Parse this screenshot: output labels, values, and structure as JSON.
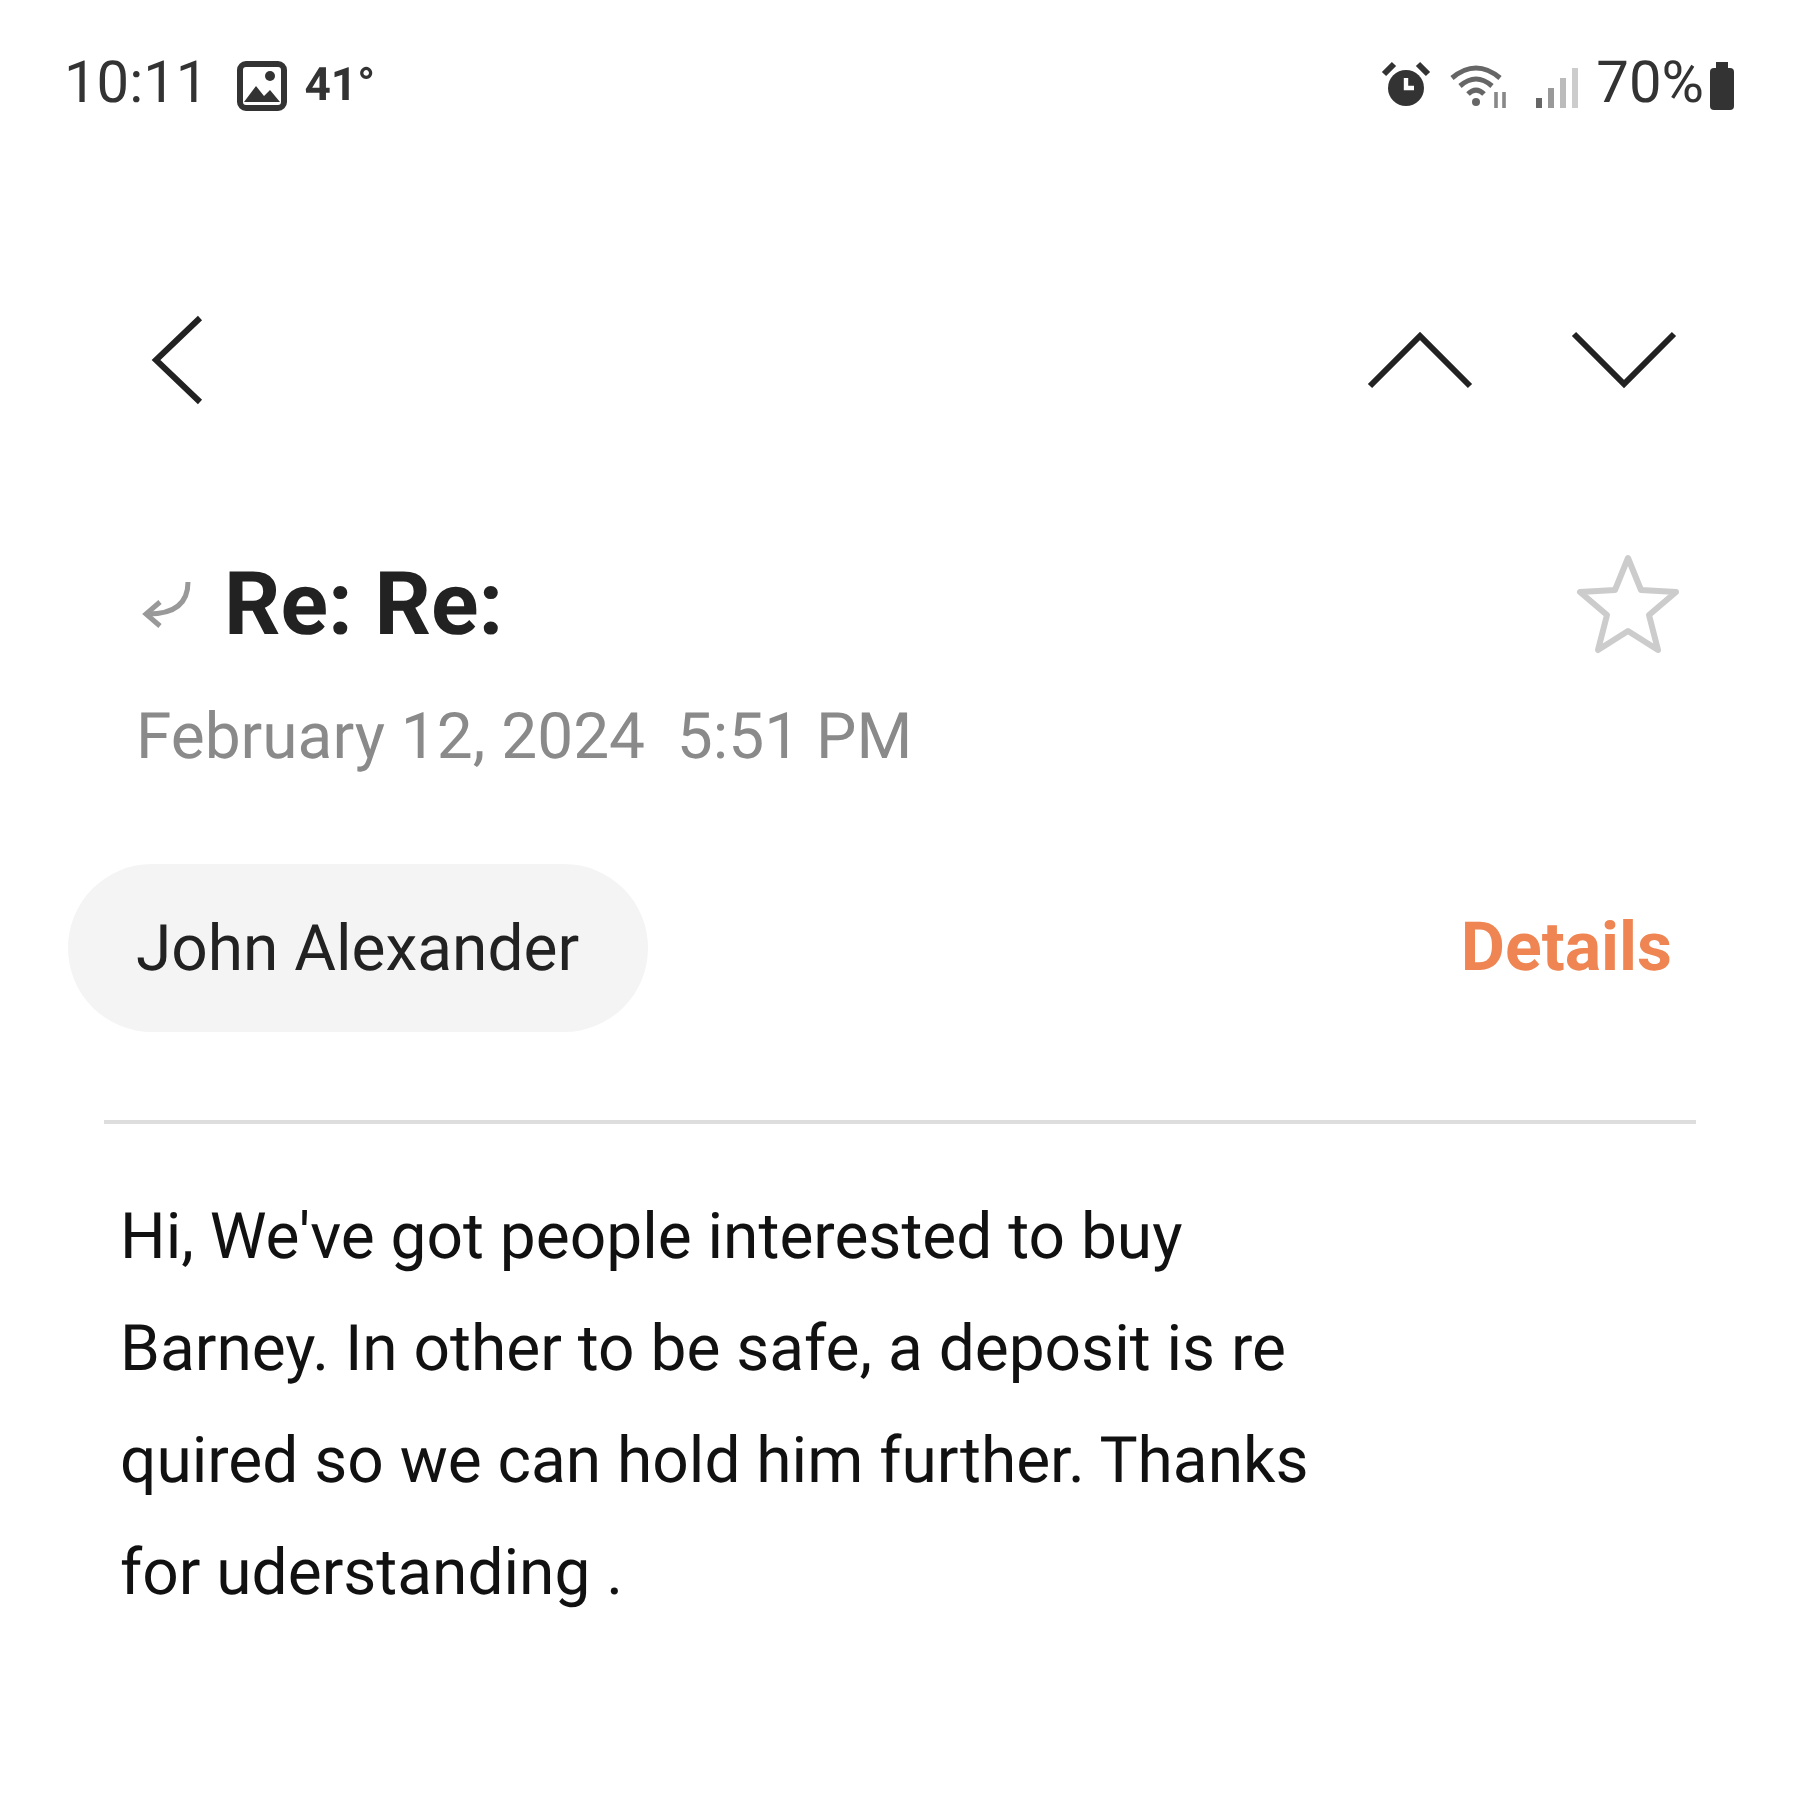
{
  "status_bar": {
    "time": "10:11",
    "temperature": "41°",
    "battery": "70%"
  },
  "subject": {
    "text": "Re: Re:",
    "replied": true,
    "starred": false
  },
  "date": "February 12, 2024  5:51 PM",
  "sender": "John Alexander",
  "details_link": "Details",
  "body": {
    "lines": [
      "Hi, We've got people interested to buy",
      "Barney. In other to be safe, a deposit is re",
      "quired so we can hold him further. Thanks",
      "for uderstanding ."
    ]
  }
}
